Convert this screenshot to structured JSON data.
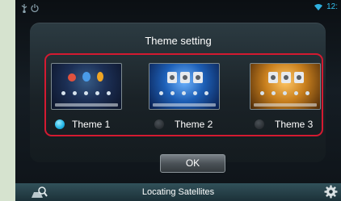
{
  "status": {
    "time": "12:"
  },
  "dialog": {
    "title": "Theme setting",
    "themes": [
      {
        "label": "Theme 1",
        "selected": true
      },
      {
        "label": "Theme 2",
        "selected": false
      },
      {
        "label": "Theme 3",
        "selected": false
      }
    ],
    "ok_label": "OK"
  },
  "bottom_bar": {
    "status_text": "Locating Satellites"
  },
  "colors": {
    "highlight_border": "#d41a31",
    "radio_selected": "#26b8e8",
    "clock": "#35c1ef"
  },
  "icons": {
    "status_left": [
      "usb-icon",
      "power-icon"
    ],
    "status_right": [
      "wifi-icon"
    ],
    "bottom_left": "map-search-icon",
    "bottom_right": "gear-icon"
  }
}
